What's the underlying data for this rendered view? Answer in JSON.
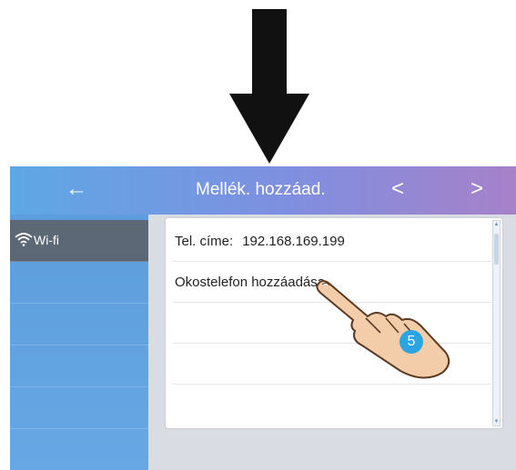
{
  "header": {
    "back_icon": "left-arrow-icon",
    "back_glyph": "←",
    "title": "Mellék. hozzáad.",
    "prev_glyph": "<",
    "next_glyph": ">"
  },
  "sidebar": {
    "items": [
      {
        "label": "Wi-fi",
        "icon": "wifi-icon",
        "active": true
      },
      {
        "label": ""
      },
      {
        "label": ""
      },
      {
        "label": ""
      },
      {
        "label": ""
      }
    ]
  },
  "content": {
    "rows": [
      {
        "label": "Tel. címe:",
        "value": "192.168.169.199"
      },
      {
        "label": "Okostelefon hozzáadása"
      },
      {
        "label": ""
      },
      {
        "label": ""
      }
    ]
  },
  "annotation": {
    "step_number": "5",
    "pointer_icon": "pointing-hand-icon",
    "down_arrow_icon": "down-arrow-icon"
  },
  "colors": {
    "header_left": "#5ea8e4",
    "header_right": "#a781c9",
    "sidebar": "#5d9ddd",
    "sidebar_active": "#5c6875",
    "badge": "#2aa5e1"
  }
}
